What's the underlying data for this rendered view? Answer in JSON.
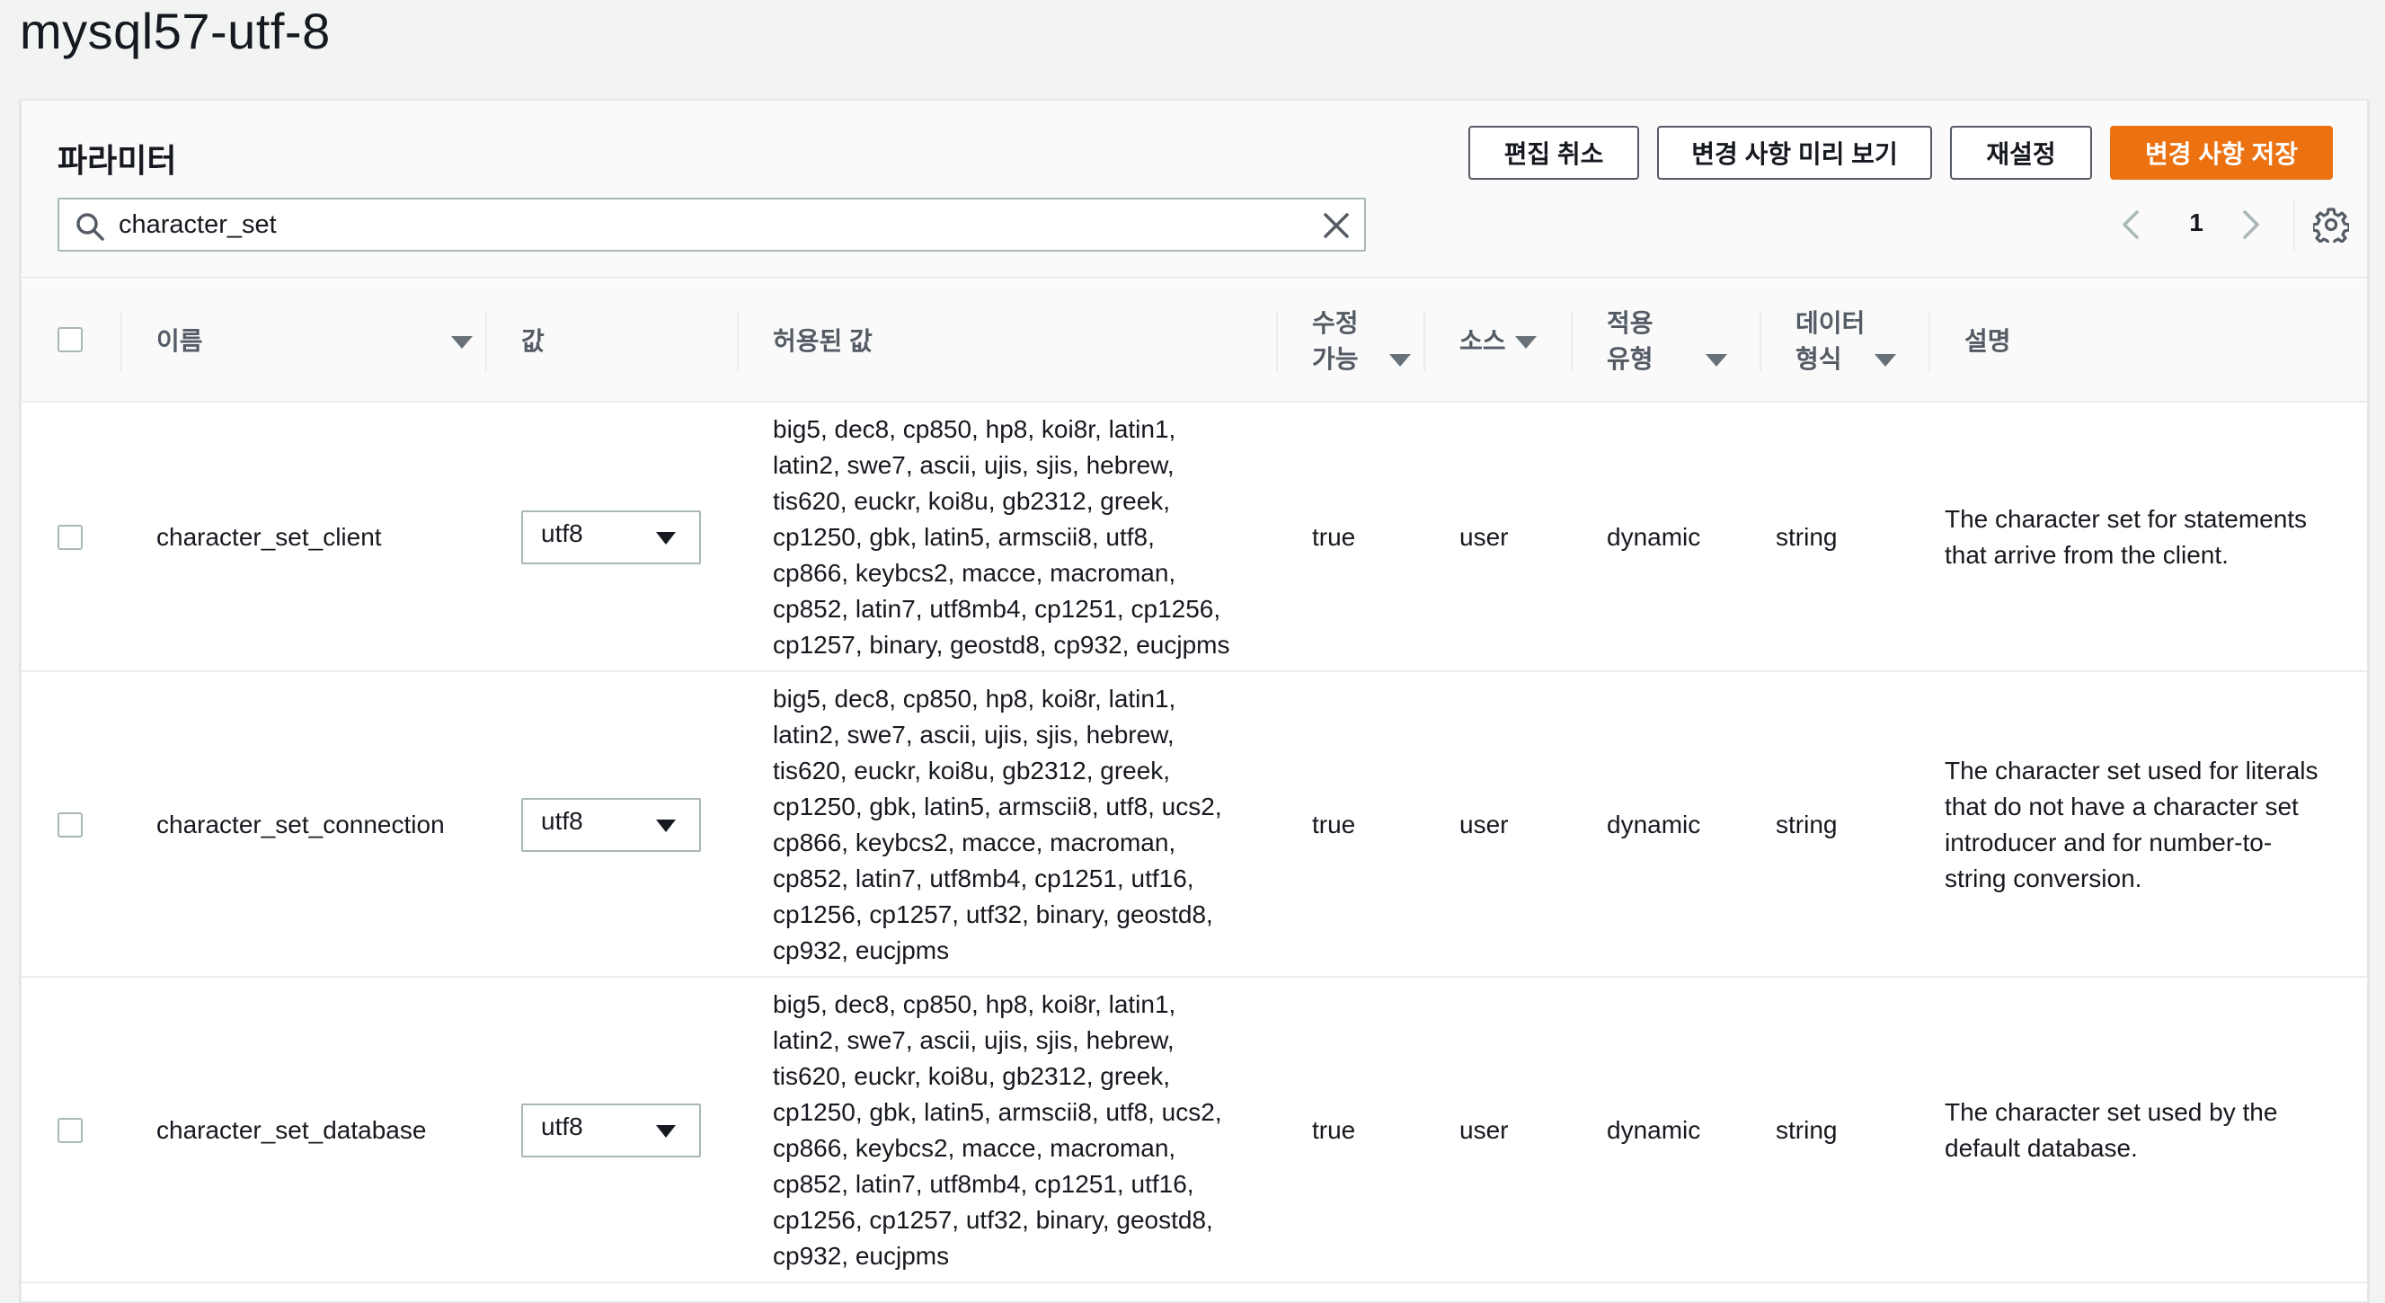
{
  "page_title": "mysql57-utf-8",
  "panel": {
    "title": "파라미터",
    "buttons": {
      "cancel_edit": "편집 취소",
      "preview_changes": "변경 사항 미리 보기",
      "reset": "재설정",
      "save_changes": "변경 사항 저장"
    },
    "search": {
      "value": "character_set",
      "icon": "search-icon"
    },
    "pagination": {
      "current_page": "1"
    }
  },
  "columns": {
    "name": "이름",
    "value": "값",
    "allowed_values": "허용된 값",
    "modifiable_1": "수정",
    "modifiable_2": "가능",
    "source": "소스",
    "apply_type_1": "적용",
    "apply_type_2": "유형",
    "data_type_1": "데이터",
    "data_type_2": "형식",
    "description": "설명"
  },
  "rows": [
    {
      "name": "character_set_client",
      "value": "utf8",
      "allowed_lines": [
        "big5, dec8, cp850, hp8, koi8r, latin1,",
        "latin2, swe7, ascii, ujis, sjis, hebrew,",
        "tis620, euckr, koi8u, gb2312, greek,",
        "cp1250, gbk, latin5, armscii8, utf8,",
        "cp866, keybcs2, macce, macroman,",
        "cp852, latin7, utf8mb4, cp1251, cp1256,",
        "cp1257, binary, geostd8, cp932, eucjpms"
      ],
      "modifiable": "true",
      "source": "user",
      "apply_type": "dynamic",
      "data_type": "string",
      "desc_lines": [
        "The character set for statements",
        "that arrive from the client."
      ]
    },
    {
      "name": "character_set_connection",
      "value": "utf8",
      "allowed_lines": [
        "big5, dec8, cp850, hp8, koi8r, latin1,",
        "latin2, swe7, ascii, ujis, sjis, hebrew,",
        "tis620, euckr, koi8u, gb2312, greek,",
        "cp1250, gbk, latin5, armscii8, utf8, ucs2,",
        "cp866, keybcs2, macce, macroman,",
        "cp852, latin7, utf8mb4, cp1251, utf16,",
        "cp1256, cp1257, utf32, binary, geostd8,",
        "cp932, eucjpms"
      ],
      "modifiable": "true",
      "source": "user",
      "apply_type": "dynamic",
      "data_type": "string",
      "desc_lines": [
        "The character set used for literals",
        "that do not have a character set",
        "introducer and for number-to-",
        "string conversion."
      ]
    },
    {
      "name": "character_set_database",
      "value": "utf8",
      "allowed_lines": [
        "big5, dec8, cp850, hp8, koi8r, latin1,",
        "latin2, swe7, ascii, ujis, sjis, hebrew,",
        "tis620, euckr, koi8u, gb2312, greek,",
        "cp1250, gbk, latin5, armscii8, utf8, ucs2,",
        "cp866, keybcs2, macce, macroman,",
        "cp852, latin7, utf8mb4, cp1251, utf16,",
        "cp1256, cp1257, utf32, binary, geostd8,",
        "cp932, eucjpms"
      ],
      "modifiable": "true",
      "source": "user",
      "apply_type": "dynamic",
      "data_type": "string",
      "desc_lines": [
        "The character set used by the",
        "default database."
      ]
    }
  ]
}
